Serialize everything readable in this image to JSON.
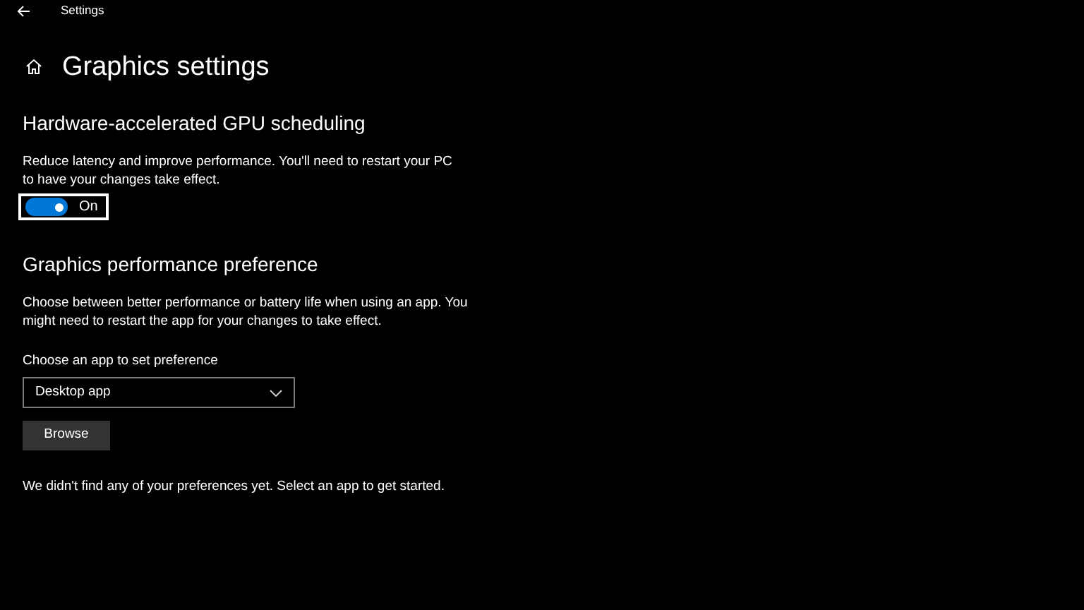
{
  "window": {
    "title": "Settings"
  },
  "page": {
    "title": "Graphics settings"
  },
  "gpu_scheduling": {
    "heading": "Hardware-accelerated GPU scheduling",
    "description": "Reduce latency and improve performance. You'll need to restart your PC to have your changes take effect.",
    "toggle": {
      "on": true,
      "label": "On",
      "focused": true
    }
  },
  "performance_preference": {
    "heading": "Graphics performance preference",
    "description": "Choose between better performance or battery life when using an app. You might need to restart the app for your changes to take effect.",
    "dropdown_label": "Choose an app to set preference",
    "dropdown": {
      "value": "Desktop app"
    },
    "browse_button": "Browse",
    "empty_message": "We didn't find any of your preferences yet. Select an app to get started."
  }
}
